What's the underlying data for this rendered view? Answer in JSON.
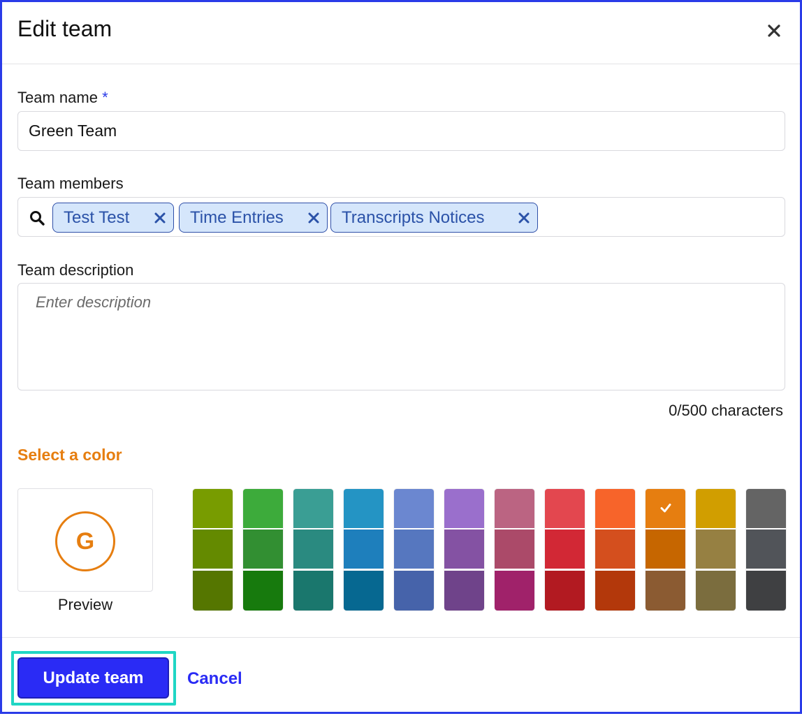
{
  "dialog": {
    "title": "Edit team",
    "close_icon": "close-icon"
  },
  "team_name": {
    "label": "Team name",
    "required_mark": "*",
    "value": "Green Team"
  },
  "team_members": {
    "label": "Team members",
    "search_icon": "search-icon",
    "chips": [
      {
        "label": "Test Test"
      },
      {
        "label": "Time Entries"
      },
      {
        "label": "Transcripts Notices"
      }
    ]
  },
  "team_description": {
    "label": "Team description",
    "placeholder": "Enter description",
    "value": "",
    "counter": "0/500 characters"
  },
  "color_picker": {
    "heading": "Select a color",
    "heading_color": "#e67e10",
    "preview_initial": "G",
    "preview_label": "Preview",
    "selected_color": "#e67e10",
    "palette": [
      [
        "#789c00",
        "#648a00",
        "#557600"
      ],
      [
        "#3dab3b",
        "#328f32",
        "#177a0d"
      ],
      [
        "#3a9e94",
        "#2a8a80",
        "#1a776d"
      ],
      [
        "#2494c4",
        "#1e7fbc",
        "#066891"
      ],
      [
        "#6b87d0",
        "#5677bf",
        "#4663aa"
      ],
      [
        "#9a6fcc",
        "#8452a3",
        "#6f438a"
      ],
      [
        "#bb6482",
        "#ab4a69",
        "#a0226a"
      ],
      [
        "#e3474f",
        "#d22835",
        "#b21a21"
      ],
      [
        "#f7642a",
        "#d44f1e",
        "#b3380b"
      ],
      [
        "#e67e10",
        "#c66600",
        "#8b5b32"
      ],
      [
        "#d19e00",
        "#968042",
        "#7b6d3e"
      ],
      [
        "#646464",
        "#515459",
        "#3f4042"
      ]
    ]
  },
  "footer": {
    "primary_label": "Update team",
    "cancel_label": "Cancel"
  }
}
